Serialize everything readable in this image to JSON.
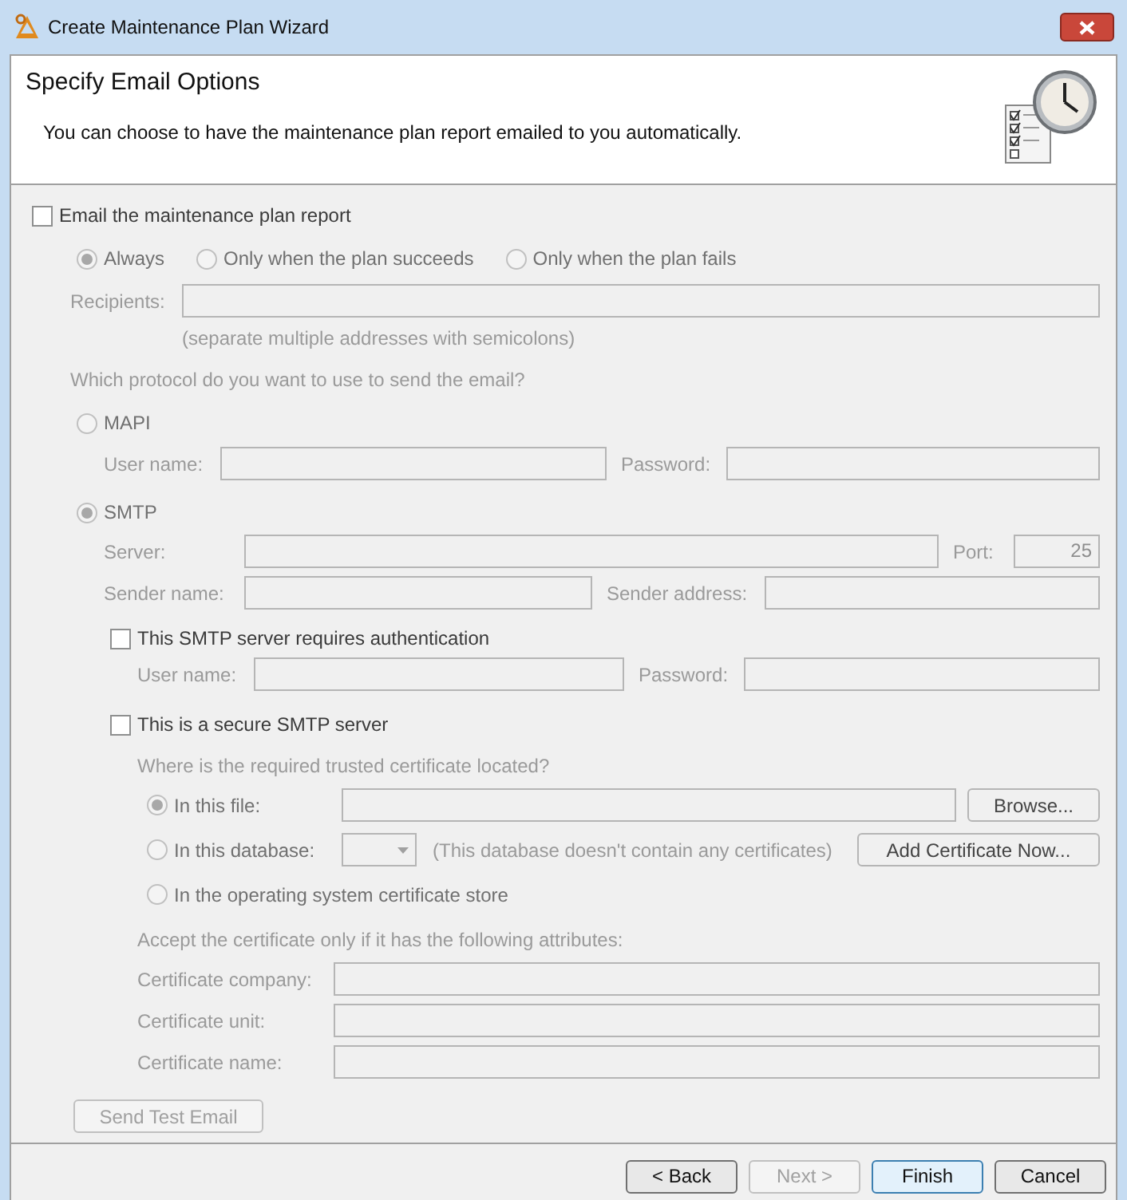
{
  "window": {
    "title": "Create Maintenance Plan Wizard"
  },
  "header": {
    "title": "Specify Email Options",
    "subtitle": "You can choose to have the maintenance plan report emailed to you automatically."
  },
  "email_report": {
    "label": "Email the maintenance plan report",
    "checked": false
  },
  "send_when": [
    {
      "label": "Always",
      "selected": true
    },
    {
      "label": "Only when the plan succeeds",
      "selected": false
    },
    {
      "label": "Only when the plan fails",
      "selected": false
    }
  ],
  "recipients": {
    "label": "Recipients:"
  },
  "recipients_hint": "(separate multiple addresses with semicolons)",
  "protocol_question": "Which protocol do you want to use to send the email?",
  "mapi": {
    "label": "MAPI",
    "selected": false,
    "user_name": {
      "label": "User name:"
    },
    "password": {
      "label": "Password:"
    }
  },
  "smtp": {
    "label": "SMTP",
    "selected": true,
    "server": {
      "label": "Server:"
    },
    "port": {
      "label": "Port:",
      "value": "25"
    },
    "sender_name": {
      "label": "Sender name:"
    },
    "sender_address": {
      "label": "Sender address:"
    },
    "authentication": {
      "label": "This SMTP server requires authentication",
      "checked": false,
      "user_name": {
        "label": "User name:"
      },
      "password": {
        "label": "Password:"
      }
    },
    "secure": {
      "label": "This is a secure SMTP server",
      "checked": false,
      "question": "Where is the required trusted certificate located?",
      "locations": [
        {
          "kind": "file",
          "label": "In this file:",
          "selected": true,
          "button": "Browse..."
        },
        {
          "kind": "database",
          "label": "In this database:",
          "selected": false,
          "note": "(This database doesn't contain any certificates)",
          "button": "Add Certificate Now..."
        },
        {
          "kind": "store",
          "label": "In the operating system certificate store",
          "selected": false
        }
      ],
      "attributes_prompt": "Accept the certificate only if it has the following attributes:",
      "attributes": [
        {
          "label": "Certificate company:"
        },
        {
          "label": "Certificate unit:"
        },
        {
          "label": "Certificate name:"
        }
      ]
    }
  },
  "test_button": {
    "label": "Send Test Email",
    "disabled": true
  },
  "footer_buttons": [
    {
      "label": "< Back",
      "disabled": false,
      "default": false
    },
    {
      "label": "Next >",
      "disabled": true,
      "default": false
    },
    {
      "label": "Finish",
      "disabled": false,
      "default": true
    },
    {
      "label": "Cancel",
      "disabled": false,
      "default": false
    }
  ]
}
